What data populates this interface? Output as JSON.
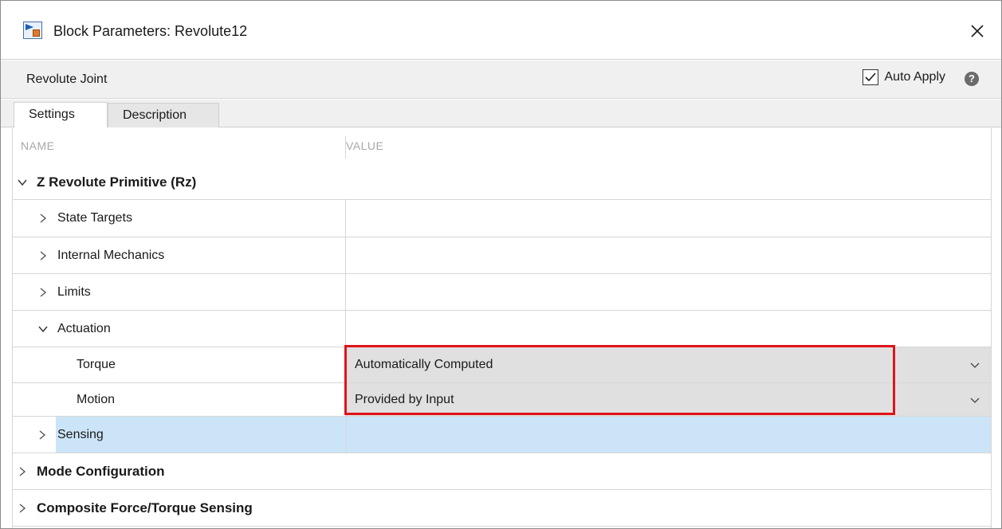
{
  "window": {
    "title": "Block Parameters: Revolute12"
  },
  "header": {
    "block_type": "Revolute Joint",
    "auto_apply_label": "Auto Apply",
    "auto_apply_checked": true
  },
  "tabs": [
    {
      "label": "Settings",
      "active": true
    },
    {
      "label": "Description",
      "active": false
    }
  ],
  "table": {
    "columns": {
      "name": "NAME",
      "value": "VALUE"
    },
    "sections": {
      "primitive": "Z Revolute Primitive (Rz)",
      "state_targets": "State Targets",
      "internal_mechanics": "Internal Mechanics",
      "limits": "Limits",
      "actuation": "Actuation",
      "torque": {
        "label": "Torque",
        "value": "Automatically Computed"
      },
      "motion": {
        "label": "Motion",
        "value": "Provided by Input"
      },
      "sensing": "Sensing",
      "mode_configuration": "Mode Configuration",
      "composite_sensing": "Composite Force/Torque Sensing"
    }
  },
  "colors": {
    "selected_row": "#cce4f7",
    "highlight": "#e0131a",
    "dropdown_bg": "#e0e0e0"
  },
  "icons": {
    "app": "simulink-block-icon",
    "close": "close-icon",
    "help": "help-icon",
    "expand": "chevron-right-icon",
    "collapse": "chevron-down-icon",
    "dropdown": "chevron-down-icon"
  }
}
